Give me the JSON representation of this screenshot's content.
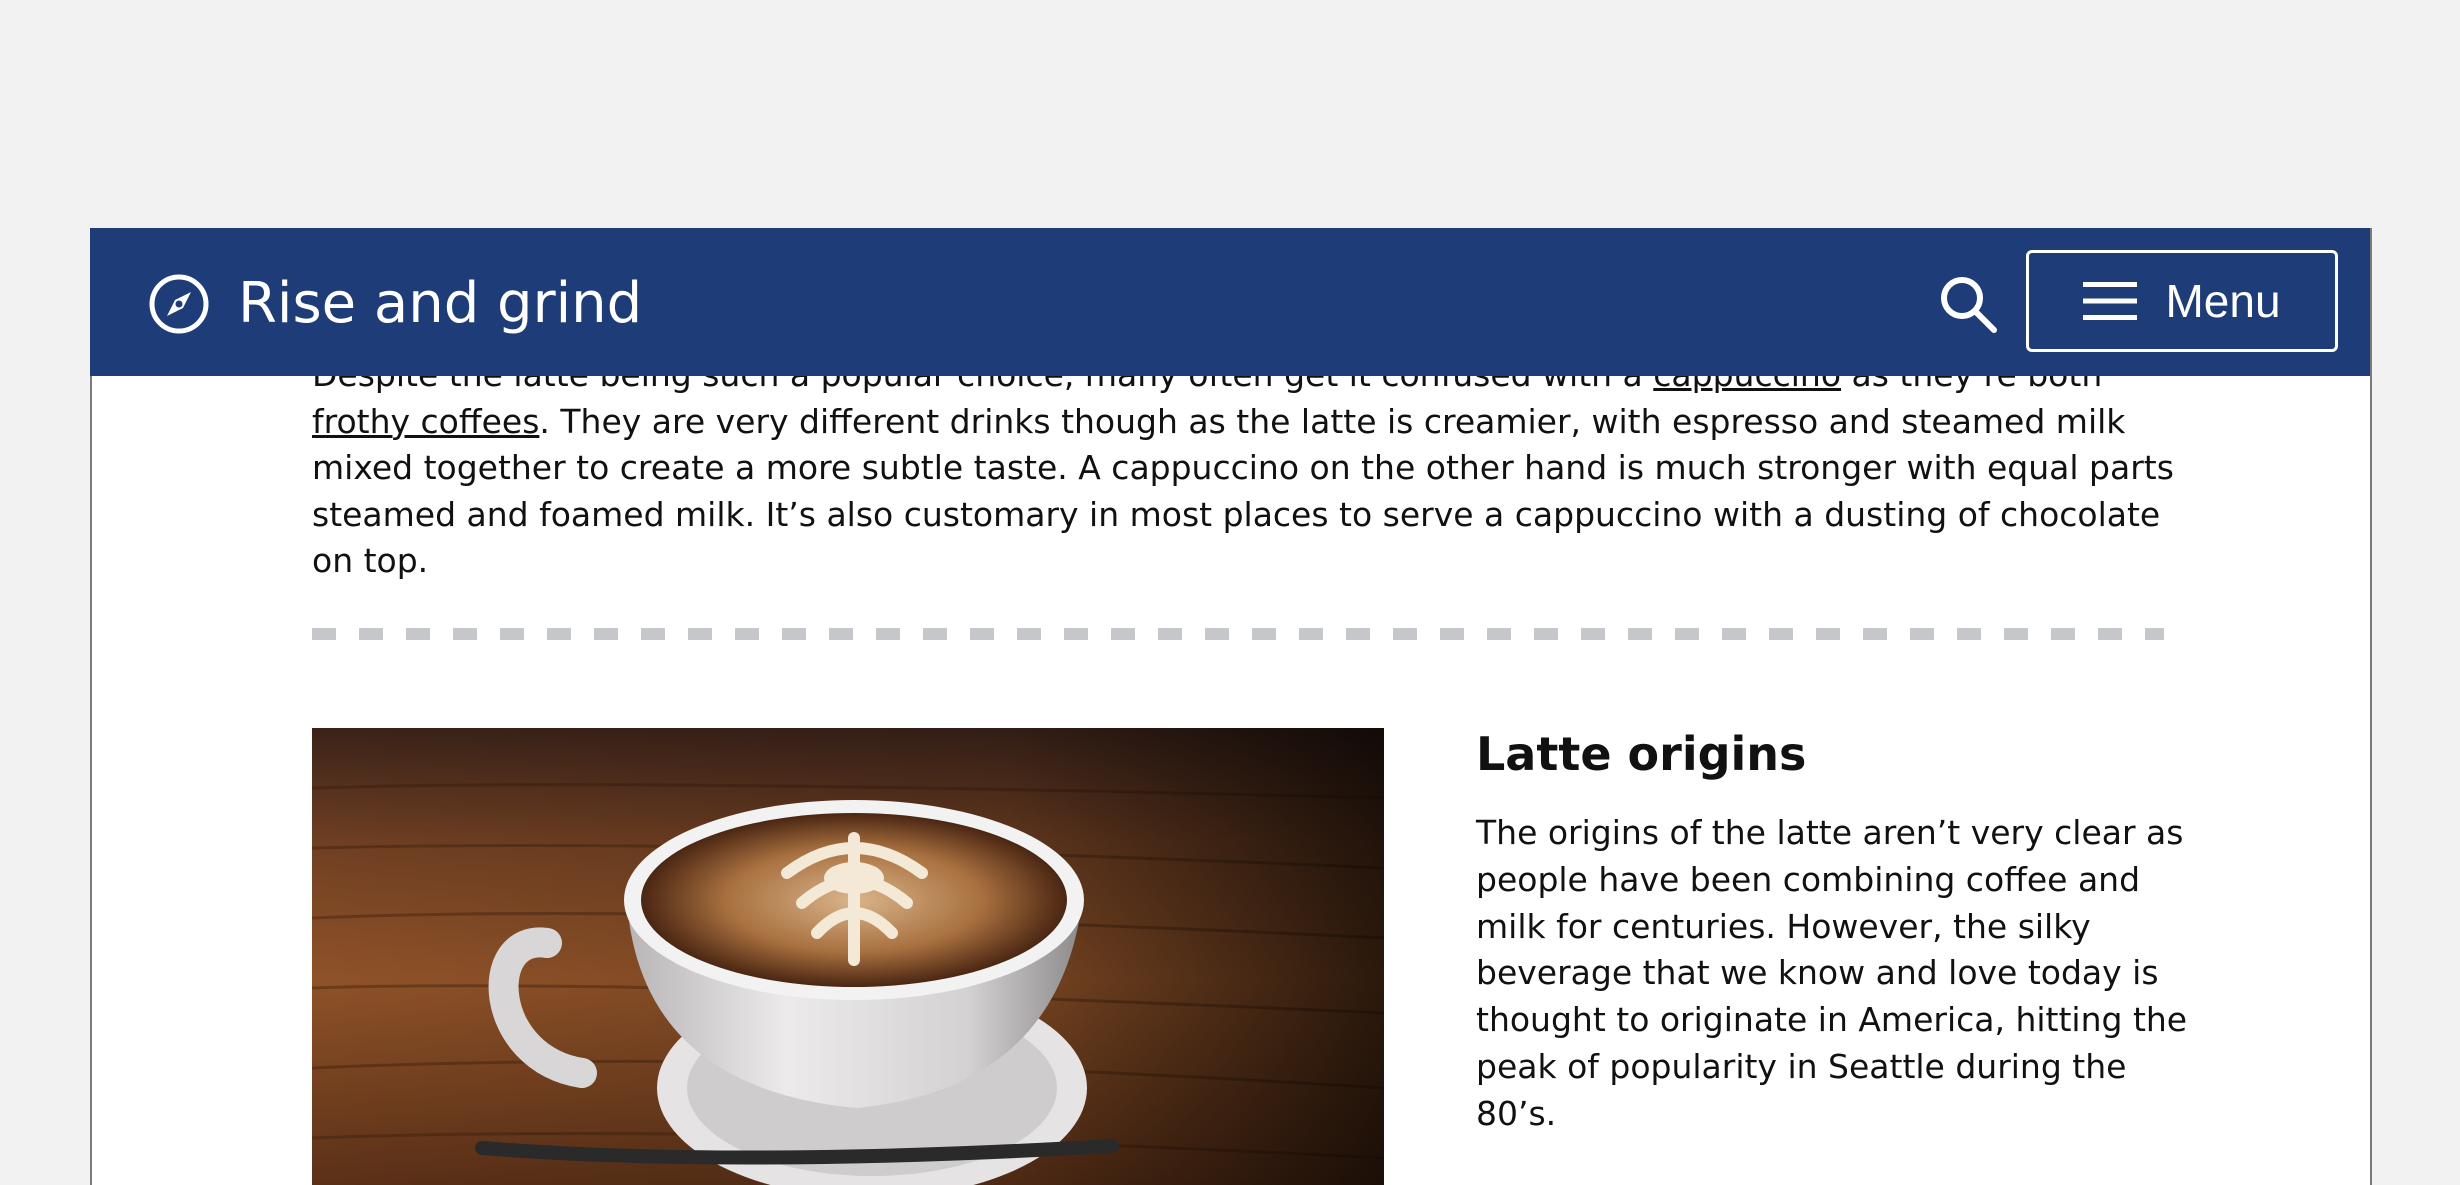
{
  "header": {
    "site_title": "Rise and grind",
    "brand_icon": "compass-icon",
    "search_icon": "search-icon",
    "menu_icon": "hamburger-icon",
    "menu_label": "Menu"
  },
  "intro": {
    "part1": "Despite the latte being such a popular choice, many often get it confused with a ",
    "link1": "cappuccino",
    "part2": " as they’re both ",
    "link2": "frothy coffees",
    "part3": ". They are very different drinks though as the latte is creamier, with espresso and steamed milk mixed together to create a more subtle taste. A cappuccino on the other hand is much stronger with equal parts steamed and foamed milk. It’s also customary in most places to serve a cappuccino with a dusting of chocolate on top."
  },
  "origins": {
    "title": "Latte origins",
    "body": "The origins of the latte aren’t very clear as people have been combining coffee and milk for centuries. However, the silky beverage that we know and love today is thought to originate in America, hitting the peak of popularity in Seattle during the 80’s."
  },
  "colors": {
    "header_bg": "#1e3c78",
    "page_bg": "#ffffff",
    "outer_bg": "#f2f2f2",
    "divider": "#c6c7cb",
    "text": "#111111"
  }
}
